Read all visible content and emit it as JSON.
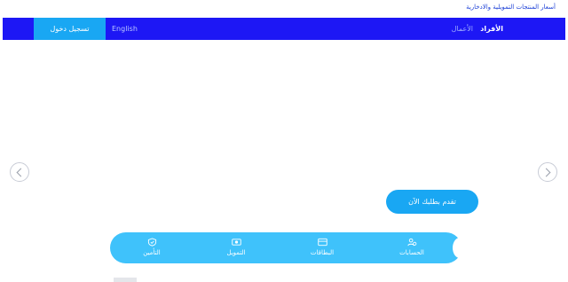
{
  "topbar": {
    "link": "أسعار المنتجات التمويلية والادخارية"
  },
  "nav": {
    "login_label": "تسجيل دخول",
    "language_label": "English",
    "tab_individuals": "الأفراد",
    "tab_business": "الأعمال"
  },
  "hero": {
    "cta_label": "تقدم بطلبك الآن"
  },
  "dock": {
    "items": [
      {
        "label": "الحسابات",
        "icon": "accounts-icon"
      },
      {
        "label": "البطاقات",
        "icon": "card-icon"
      },
      {
        "label": "التمويل",
        "icon": "cash-icon"
      },
      {
        "label": "التأمين",
        "icon": "insurance-icon"
      }
    ]
  },
  "colors": {
    "nav_bg": "#1d17f5",
    "login_bg": "#19a7f3",
    "dock_bg": "#3fc2fb",
    "link": "#1b3fd6"
  }
}
